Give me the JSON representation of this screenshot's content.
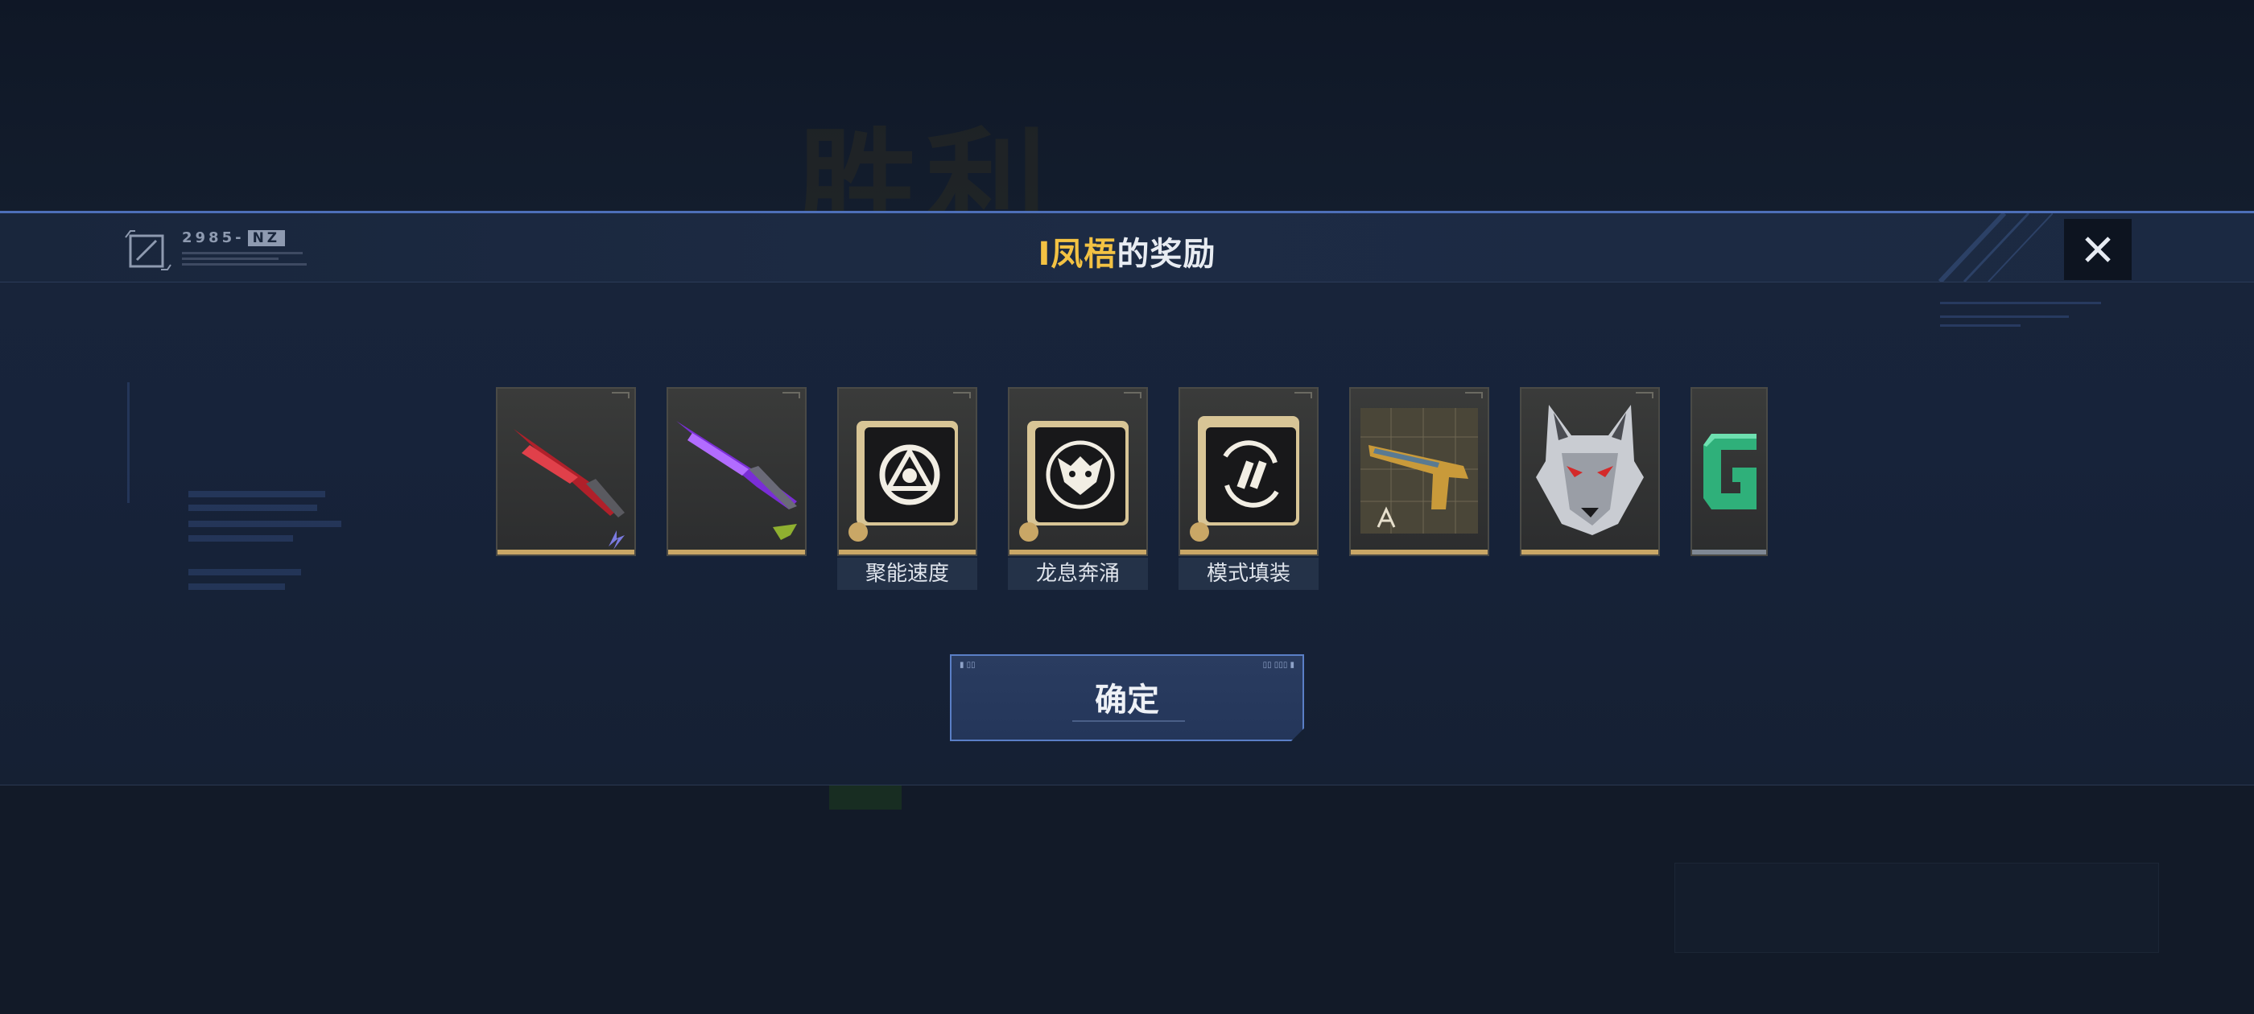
{
  "background": {
    "victory_text": "胜利"
  },
  "header": {
    "title_highlight": "I凤梧",
    "title_rest": "的奖励",
    "brand_text": "2985-",
    "brand_tag": "NZ",
    "close_icon": "close-icon"
  },
  "rewards": [
    {
      "name": "red-blade-weapon",
      "icon": "red-blade-icon",
      "label": ""
    },
    {
      "name": "purple-blade-weapon",
      "icon": "purple-blade-icon",
      "label": ""
    },
    {
      "name": "mod-juneng-sudu",
      "icon": "triangle-emblem-icon",
      "label": "聚能速度"
    },
    {
      "name": "mod-longxi-benyong",
      "icon": "dragon-emblem-icon",
      "label": "龙息奔涌"
    },
    {
      "name": "mod-moshi-tianzhuang",
      "icon": "reload-emblem-icon",
      "label": "模式填装"
    },
    {
      "name": "pistol-blueprint",
      "icon": "pistol-blueprint-icon",
      "label": ""
    },
    {
      "name": "wolf-avatar",
      "icon": "wolf-head-icon",
      "label": ""
    },
    {
      "name": "green-g-item",
      "icon": "letter-g-icon",
      "label": ""
    }
  ],
  "confirm_button": {
    "label": "确定"
  },
  "colors": {
    "accent_blue": "#4d6fb8",
    "highlight_gold": "#f3c243",
    "card_gold": "#c9a766"
  }
}
